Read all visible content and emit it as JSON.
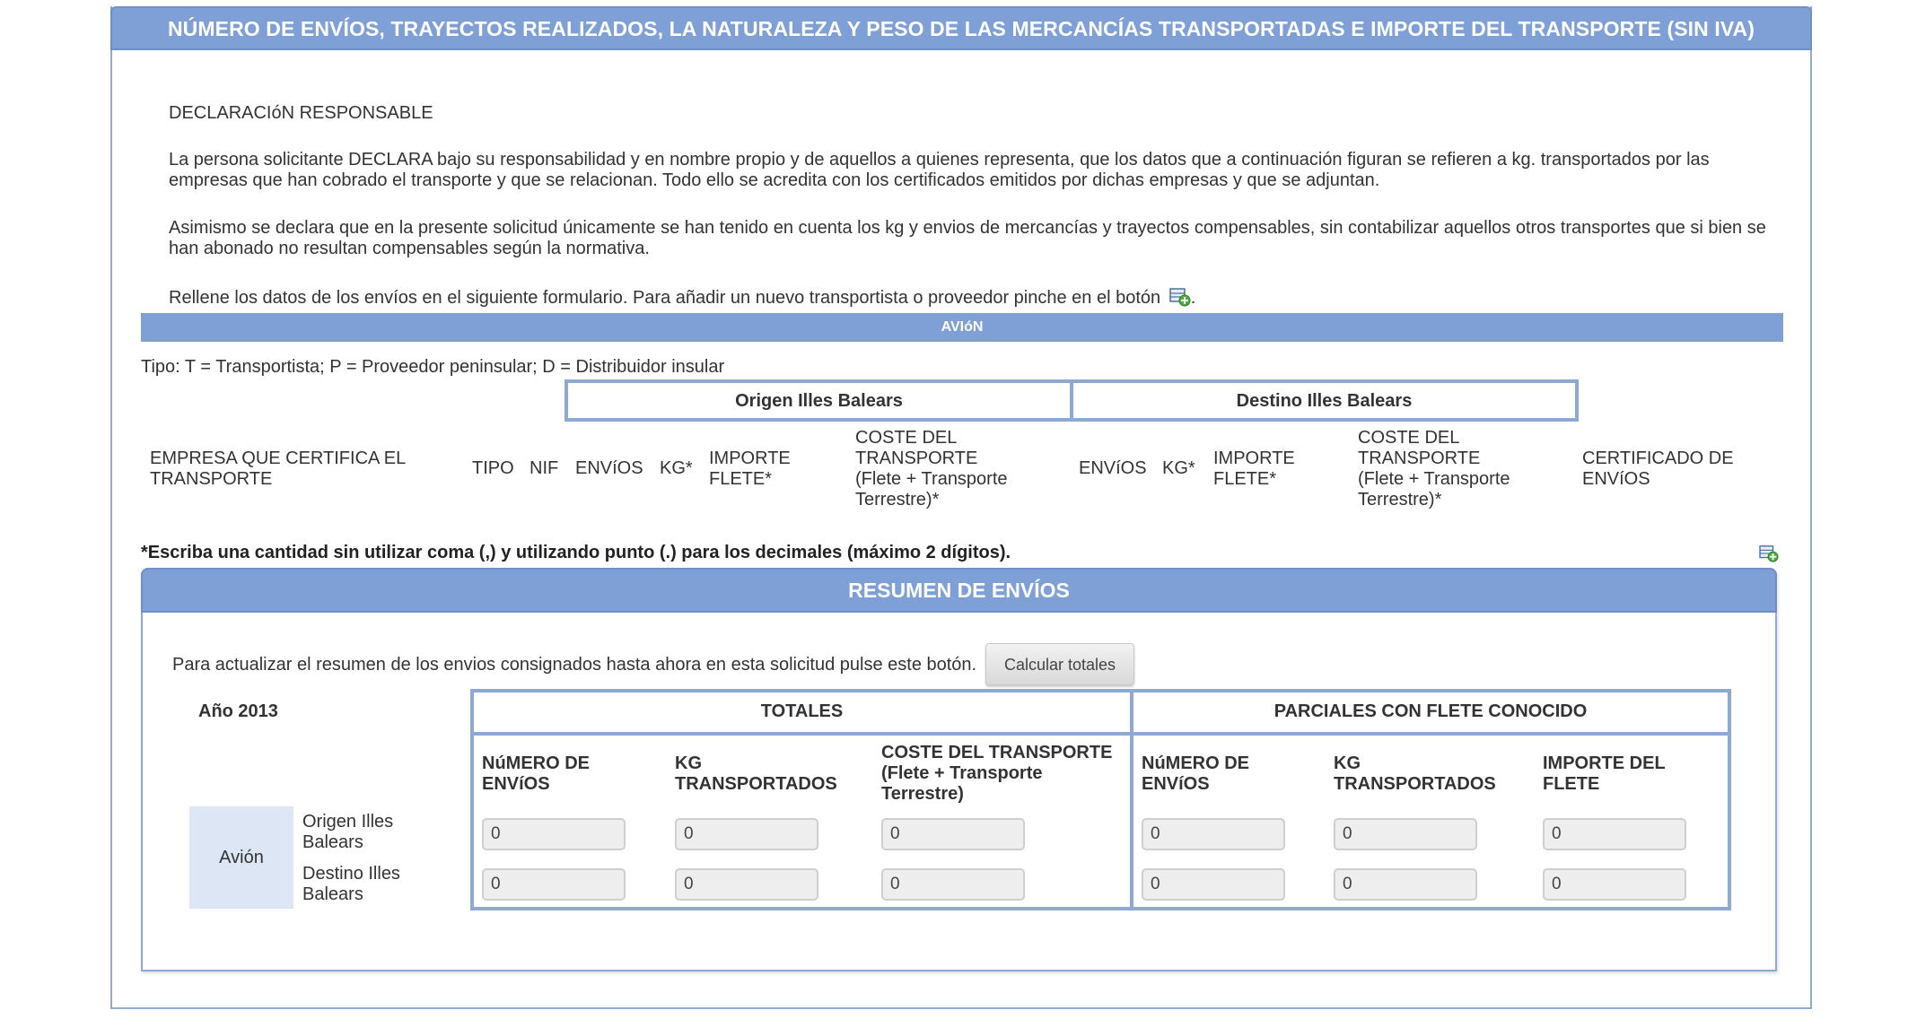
{
  "header": {
    "title": "NÚMERO DE ENVÍOS, TRAYECTOS REALIZADOS, LA NATURALEZA Y PESO DE LAS MERCANCÍAS TRANSPORTADAS E IMPORTE DEL TRANSPORTE (SIN IVA)"
  },
  "declaration": {
    "title": "DECLARACIóN RESPONSABLE",
    "para1": "La persona solicitante DECLARA bajo su responsabilidad y en nombre propio y de aquellos a quienes representa, que los datos que a continuación figuran se refieren a kg. transportados por las empresas que han cobrado el transporte y que se relacionan. Todo ello se acredita con los certificados emitidos por dichas empresas y que se adjuntan.",
    "para2": "Asimismo se declara que en la presente solicitud únicamente se han tenido en cuenta los kg y envios de mercancías y trayectos compensables, sin contabilizar aquellos otros transportes que si bien se han abonado no resultan compensables según la normativa.",
    "para3": "Rellene los datos de los envíos en el siguiente formulario. Para añadir un nuevo transportista o proveedor pinche en el botón",
    "para3_end": "."
  },
  "section": {
    "title": "AVIóN",
    "tipo_legend": "Tipo: T = Transportista; P = Proveedor peninsular; D = Distribuidor insular",
    "group_origen": "Origen Illes Balears",
    "group_destino": "Destino Illes Balears",
    "columns": {
      "empresa": "EMPRESA QUE CERTIFICA EL TRANSPORTE",
      "tipo": "TIPO",
      "nif": "NIF",
      "envios": "ENVíOS",
      "kg": "KG*",
      "importe": "IMPORTE FLETE*",
      "coste": "COSTE DEL TRANSPORTE (Flete + Transporte Terrestre)*",
      "certificado": "CERTIFICADO DE ENVíOS"
    },
    "note": "*Escriba una cantidad sin utilizar coma (,) y utilizando punto (.) para los decimales (máximo 2 dígitos)."
  },
  "resumen": {
    "title": "RESUMEN DE ENVÍOS",
    "instruction": "Para actualizar el resumen de los envios consignados hasta ahora en esta solicitud pulse este botón.",
    "button_label": "Calcular totales",
    "year": "Año 2013",
    "totales_header": "TOTALES",
    "parciales_header": "PARCIALES CON FLETE CONOCIDO",
    "sub": {
      "num_envios": "NúMERO DE ENVíOS",
      "kg": "KG TRANSPORTADOS",
      "coste": "COSTE DEL TRANSPORTE (Flete + Transporte Terrestre)",
      "importe": "IMPORTE DEL FLETE"
    },
    "mode": "Avión",
    "row_origen": "Origen Illes Balears",
    "row_destino": "Destino Illes Balears",
    "values": {
      "origen": [
        "0",
        "0",
        "0",
        "0",
        "0",
        "0"
      ],
      "destino": [
        "0",
        "0",
        "0",
        "0",
        "0",
        "0"
      ]
    }
  }
}
